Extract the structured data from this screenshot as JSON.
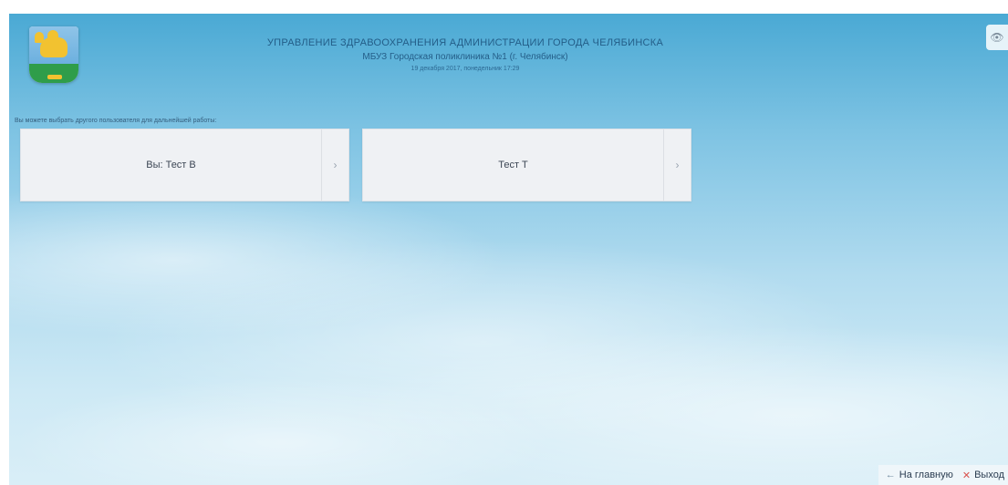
{
  "header": {
    "title": "УПРАВЛЕНИЕ ЗДРАВООХРАНЕНИЯ АДМИНИСТРАЦИИ ГОРОДА ЧЕЛЯБИНСКА",
    "subtitle": "МБУЗ Городская поликлиника №1 (г. Челябинск)",
    "date": "19 декабря 2017, понедельник 17:29"
  },
  "prompt": "Вы можете выбрать другого пользователя для дальнейшей работы:",
  "cards": [
    {
      "label": "Вы: Тест В",
      "arrow": "›"
    },
    {
      "label": "Тест Т",
      "arrow": "›"
    }
  ],
  "icons": {
    "logo": "chelyabinsk-coat-of-arms",
    "corner": "eye-icon",
    "home": "arrow-left-icon",
    "exit": "close-icon"
  },
  "corner_glyph": "👁",
  "footer": {
    "home_glyph": "←",
    "home_label": "На главную",
    "exit_glyph": "✕",
    "exit_label": "Выход"
  },
  "colors": {
    "sky_top": "#4aa9d4",
    "card_bg": "#eff1f4",
    "exit_accent": "#d9534f"
  }
}
